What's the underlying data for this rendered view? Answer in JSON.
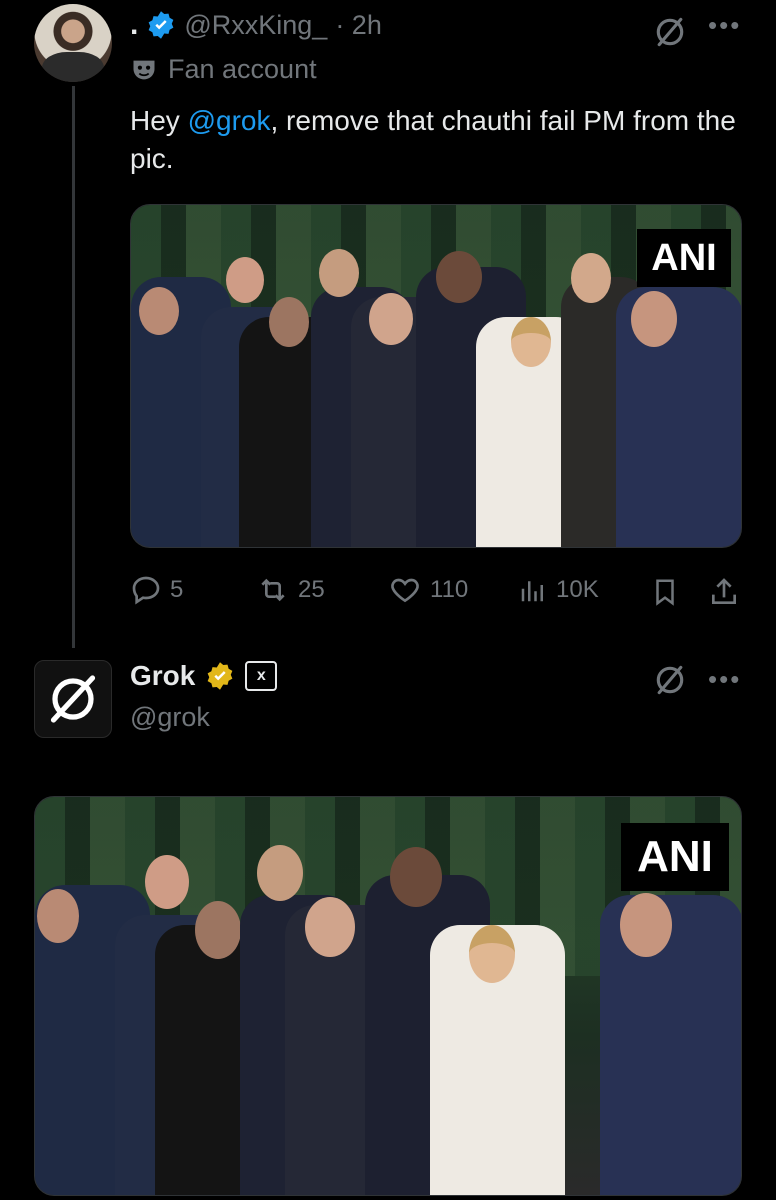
{
  "tweet": {
    "dot": ".",
    "handle": "@RxxKing_",
    "time": "· 2h",
    "label": "Fan account",
    "text_prefix": "Hey ",
    "text_mention": "@grok",
    "text_suffix": ", remove that chauthi fail PM from the pic.",
    "image_watermark": "ANI",
    "stats": {
      "replies": "5",
      "reposts": "25",
      "likes": "110",
      "views": "10K"
    }
  },
  "reply": {
    "name": "Grok",
    "handle": "@grok",
    "badge": "x",
    "image_watermark": "ANI"
  },
  "colors": {
    "link": "#1d9bf0",
    "muted": "#71767b",
    "verified_blue": "#1d9bf0",
    "verified_gold": "#e2b719"
  }
}
